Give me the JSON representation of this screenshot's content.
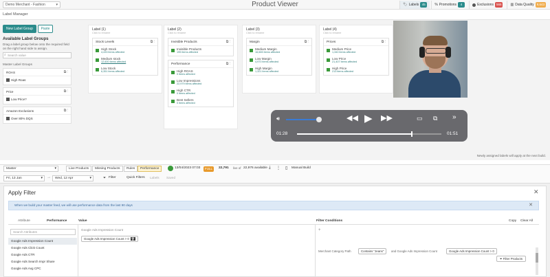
{
  "topbar": {
    "merchant": "Demo Merchant - Fashion",
    "title": "Product Viewer",
    "nav": [
      {
        "label": "Labels",
        "badge": "45",
        "badge_color": "#2a8b8b",
        "active": true
      },
      {
        "label": "Promotions",
        "badge": "4",
        "badge_color": "#2a8b8b",
        "active": false
      },
      {
        "label": "Exclusions",
        "badge": "565",
        "badge_color": "#d9534f",
        "active": false
      },
      {
        "label": "Data Quality",
        "badge": "9,643",
        "badge_color": "#f0ad4e",
        "active": false
      }
    ]
  },
  "label_manager": {
    "title": "Label Manager",
    "new_group_btn": "New Label Group",
    "paste_btn": "Paste",
    "available_title": "Available Label Groups",
    "available_desc": "Drag a label group below onto the required field on the right hand side to assign.",
    "search_placeholder": "Search value",
    "master_title": "Master Label Groups",
    "groups": [
      {
        "name": "ROAS",
        "item": "High Roas"
      },
      {
        "name": "Price",
        "item": "Low Price?"
      },
      {
        "name": "Amazon Exclusions",
        "item": "Over 80% DQS"
      }
    ],
    "columns": [
      {
        "label": "Label (1)",
        "sub": "Click to rename",
        "boxes": [
          {
            "title": "Stock Levels",
            "items": [
              {
                "name": "High Stock",
                "count": "4,433 items affected"
              },
              {
                "name": "Medium stock",
                "count": "12,600 items affected"
              },
              {
                "name": "Low Stock",
                "count": "6,351 items affected"
              }
            ]
          }
        ]
      },
      {
        "label": "Label (2)",
        "sub": "Click to rename",
        "boxes": [
          {
            "title": "Invisible Products",
            "items": [
              {
                "name": "Invisible Products",
                "count": "195 items affected"
              }
            ]
          },
          {
            "title": "Performance",
            "items": [
              {
                "name": "High ROAS",
                "count": "0 items affected"
              },
              {
                "name": "Low Impressions",
                "count": "22,979 items affected"
              },
              {
                "name": "High CTR",
                "count": "0 items affected"
              },
              {
                "name": "Best Sellers",
                "count": "0 items affected"
              }
            ]
          }
        ]
      },
      {
        "label": "Label (3)",
        "sub": "Click to rename",
        "boxes": [
          {
            "title": "Margin",
            "items": [
              {
                "name": "Medium Margin",
                "count": "16,665 items affected"
              },
              {
                "name": "Low Margin",
                "count": "4,970 items affected"
              },
              {
                "name": "High Margin",
                "count": "1,321 items affected"
              }
            ]
          }
        ]
      },
      {
        "label": "Label (4)",
        "sub": "Click to rename",
        "boxes": [
          {
            "title": "Prices",
            "items": [
              {
                "name": "Medium Price",
                "count": "1,340 items affected"
              },
              {
                "name": "Low Price",
                "count": "21,407 items affected"
              },
              {
                "name": "High Price",
                "count": "213 items affected"
              }
            ]
          }
        ]
      }
    ],
    "note": "Newly assigned labels will apply at the next build."
  },
  "player": {
    "current": "01:28",
    "total": "01:51",
    "progress": 0.79,
    "volume": 0.92
  },
  "toolbar": {
    "feed": "Master",
    "tabs": [
      "Live Products",
      "Missing Products",
      "Rules",
      "Performance"
    ],
    "active_tab": "Performance",
    "build_date": "13/04/2023 07:03",
    "build_badge": "FULL",
    "live_count": "22,791",
    "live_suffix": "live of",
    "available": "22,976 available",
    "manual_build": "Manual Build",
    "date_from": "Fri, 13 Jan",
    "date_to": "Wed, 12 Apr",
    "filter": "Filter",
    "quick_filters": "Quick Filters",
    "labels": "Labels",
    "saved": "Saved"
  },
  "apply_filter": {
    "title": "Apply Filter",
    "info": "When we build your master feed, we will use performance data from the last 90 days",
    "info_bold": "90 days",
    "col_attribute": "Attribute",
    "col_performance": "Performance",
    "col_value": "Value",
    "col_conditions": "Filter Conditions",
    "copy": "Copy",
    "clear_all": "Clear All",
    "attr_search": "Search Attributes",
    "attributes": [
      "Google Ads Impression Count",
      "Google Ads Click Count",
      "Google Ads CTR",
      "Google Ads Search Impr Share",
      "Google Ads Avg CPC"
    ],
    "value_title": "Google Ads Impression Count",
    "value_chip": "Google Ads Impression Count > 0",
    "cond_plus": "+",
    "cond_text1": "Merchant Category Path",
    "cond_chip1": "Contains \"Jeans\"",
    "cond_text2": "and Google Ads Impression Count",
    "cond_chip2": "Google Ads Impression Count > 0",
    "filter_products": "Filter Products"
  }
}
